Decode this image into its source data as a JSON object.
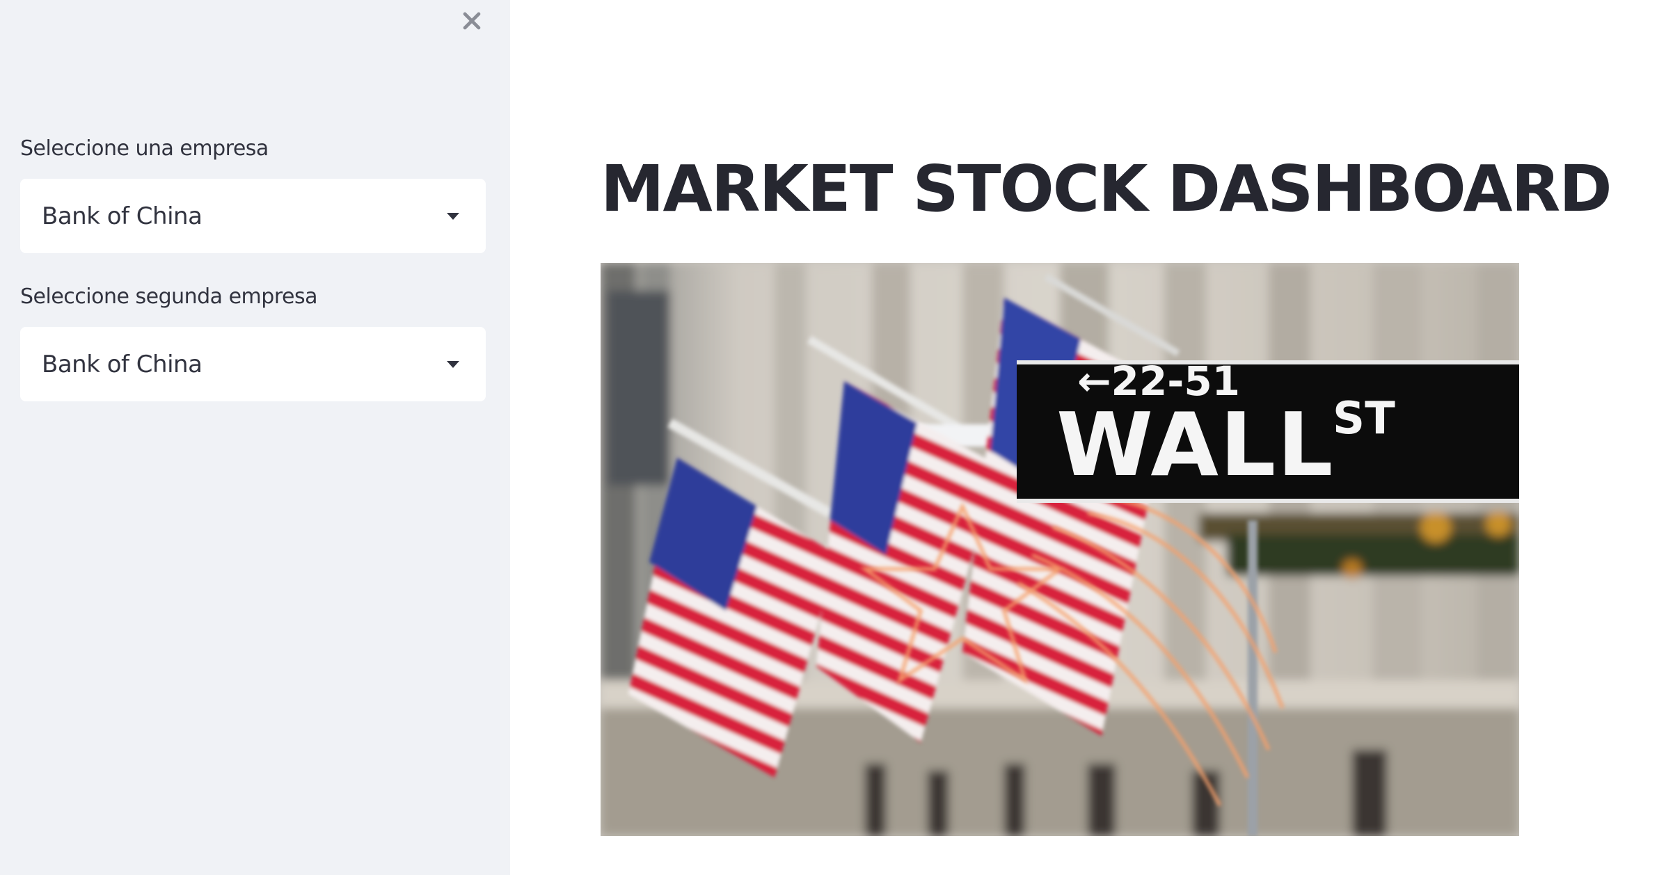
{
  "sidebar": {
    "close_icon": "close-icon",
    "first_select": {
      "label": "Seleccione una empresa",
      "value": "Bank of China"
    },
    "second_select": {
      "label": "Seleccione segunda empresa",
      "value": "Bank of China"
    }
  },
  "main": {
    "title": "MARKET STOCK DASHBOARD",
    "hero_image": {
      "sign_number": "←22-51",
      "sign_street": "WALL",
      "sign_suffix": "ST"
    }
  },
  "colors": {
    "sidebar_bg": "#f0f2f6",
    "text": "#31333f",
    "title": "#262730"
  }
}
